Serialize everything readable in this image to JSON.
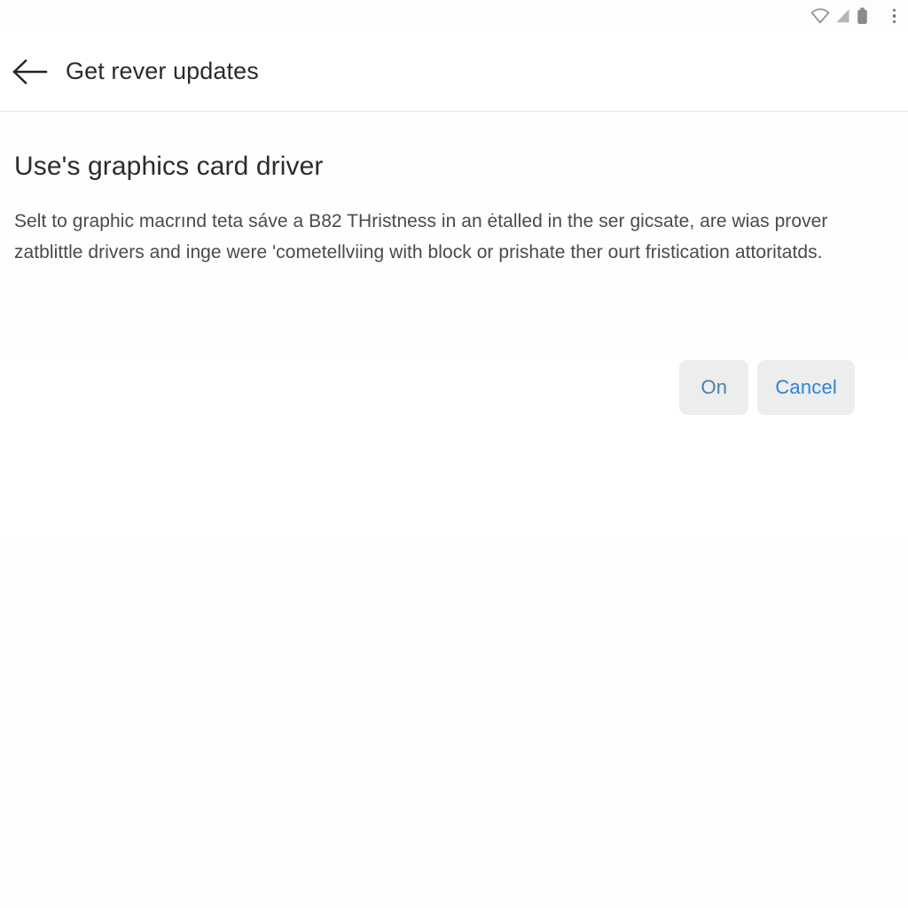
{
  "status_bar": {
    "icons": [
      {
        "name": "wifi-icon",
        "label": "wifi"
      },
      {
        "name": "signal-icon",
        "label": "cellular signal"
      },
      {
        "name": "battery-icon",
        "label": "battery"
      }
    ],
    "overflow_menu": {
      "name": "overflow-menu-icon",
      "label": "More options"
    }
  },
  "header": {
    "back_label": "Back",
    "title": "Get rever updates"
  },
  "main": {
    "heading": "Use's graphics card driver",
    "body": "Selt to graphic macrınd teta sáve a B82 THristness in an ėtalled in the ser gicsate, are wias prover zatblittle drivers and inge were 'cometellviing with block or prishate ther ourt fristication attoritatds."
  },
  "actions": {
    "confirm_label": "On",
    "cancel_label": "Cancel"
  },
  "colors": {
    "background": "#ffffff",
    "divider": "#e6e6e6",
    "heading_text": "#2c2c2c",
    "body_text": "#4a4a4a",
    "button_bg": "#eceded",
    "confirm_text": "#4a7fae",
    "cancel_text": "#2f82d6",
    "status_icon": "#8a8a8a"
  }
}
